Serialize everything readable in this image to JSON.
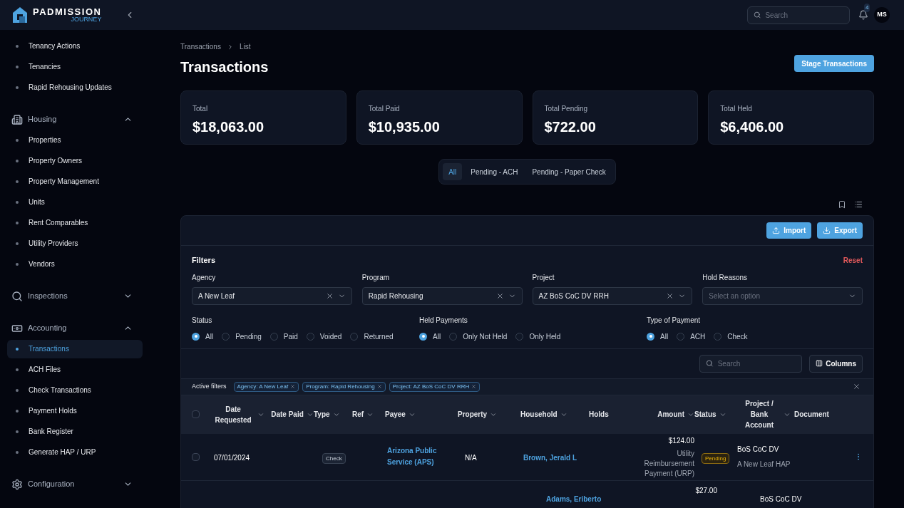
{
  "brand": {
    "name": "PADMISSION",
    "sub": "JOURNEY"
  },
  "topbar": {
    "search_placeholder": "Search",
    "notifications": "4",
    "avatar": "MS"
  },
  "sidebar": [
    {
      "kind": "item",
      "label": "Tenancy Actions",
      "selected": false
    },
    {
      "kind": "item",
      "label": "Tenancies",
      "selected": false
    },
    {
      "kind": "item",
      "label": "Rapid Rehousing Updates",
      "selected": false
    },
    {
      "kind": "section",
      "label": "Housing",
      "expanded": true
    },
    {
      "kind": "item",
      "label": "Properties",
      "selected": false
    },
    {
      "kind": "item",
      "label": "Property Owners",
      "selected": false
    },
    {
      "kind": "item",
      "label": "Property Management",
      "selected": false
    },
    {
      "kind": "item",
      "label": "Units",
      "selected": false
    },
    {
      "kind": "item",
      "label": "Rent Comparables",
      "selected": false
    },
    {
      "kind": "item",
      "label": "Utility Providers",
      "selected": false
    },
    {
      "kind": "item",
      "label": "Vendors",
      "selected": false
    },
    {
      "kind": "section",
      "label": "Inspections",
      "expanded": false
    },
    {
      "kind": "section",
      "label": "Accounting",
      "expanded": true
    },
    {
      "kind": "item",
      "label": "Transactions",
      "selected": true
    },
    {
      "kind": "item",
      "label": "ACH Files",
      "selected": false
    },
    {
      "kind": "item",
      "label": "Check Transactions",
      "selected": false
    },
    {
      "kind": "item",
      "label": "Payment Holds",
      "selected": false
    },
    {
      "kind": "item",
      "label": "Bank Register",
      "selected": false
    },
    {
      "kind": "item",
      "label": "Generate HAP / URP",
      "selected": false
    },
    {
      "kind": "section",
      "label": "Configuration",
      "expanded": false
    }
  ],
  "breadcrumb": [
    "Transactions",
    "List"
  ],
  "title": "Transactions",
  "stage_button": "Stage Transactions",
  "stats": [
    {
      "label": "Total",
      "value": "$18,063.00"
    },
    {
      "label": "Total Paid",
      "value": "$10,935.00"
    },
    {
      "label": "Total Pending",
      "value": "$722.00"
    },
    {
      "label": "Total Held",
      "value": "$6,406.00"
    }
  ],
  "tabs": [
    {
      "label": "All",
      "selected": true
    },
    {
      "label": "Pending - ACH",
      "selected": false
    },
    {
      "label": "Pending - Paper Check",
      "selected": false
    }
  ],
  "import_button": "Import",
  "export_button": "Export",
  "filters": {
    "title": "Filters",
    "reset": "Reset",
    "selects": [
      {
        "label": "Agency",
        "value": "A New Leaf"
      },
      {
        "label": "Program",
        "value": "Rapid Rehousing"
      },
      {
        "label": "Project",
        "value": "AZ BoS CoC DV RRH"
      },
      {
        "label": "Hold Reasons",
        "placeholder": "Select an option"
      }
    ],
    "radio_groups": [
      {
        "label": "Status",
        "options": [
          {
            "label": "All",
            "selected": true
          },
          {
            "label": "Pending",
            "selected": false
          },
          {
            "label": "Paid",
            "selected": false
          },
          {
            "label": "Voided",
            "selected": false
          },
          {
            "label": "Returned",
            "selected": false
          }
        ]
      },
      {
        "label": "Held Payments",
        "options": [
          {
            "label": "All",
            "selected": true
          },
          {
            "label": "Only Not Held",
            "selected": false
          },
          {
            "label": "Only Held",
            "selected": false
          }
        ]
      },
      {
        "label": "Type of Payment",
        "options": [
          {
            "label": "All",
            "selected": true
          },
          {
            "label": "ACH",
            "selected": false
          },
          {
            "label": "Check",
            "selected": false
          }
        ]
      }
    ]
  },
  "table_search_placeholder": "Search",
  "columns_button": "Columns",
  "active_filters": {
    "label": "Active filters",
    "chips": [
      "Agency: A New Leaf",
      "Program: Rapid Rehousing",
      "Project: AZ BoS CoC DV RRH"
    ]
  },
  "table": {
    "select_all_checked": false,
    "columns": [
      {
        "label": "Date Requested"
      },
      {
        "label": "Date Paid"
      },
      {
        "label": "Type"
      },
      {
        "label": "Ref"
      },
      {
        "label": "Payee"
      },
      {
        "label": "Property"
      },
      {
        "label": "Household"
      },
      {
        "label": "Holds"
      },
      {
        "label": "Amount"
      },
      {
        "label": "Status"
      },
      {
        "label": "Project / Bank Account"
      },
      {
        "label": "Document"
      }
    ],
    "rows": [
      {
        "checked": false,
        "date_requested": "07/01/2024",
        "type": "Check",
        "payee": "Arizona Public Service (APS)",
        "property": "N/A",
        "household": "Brown, Jerald L",
        "amount": "$124.00",
        "amount_note": "Utility Reimbursement Payment (URP)",
        "status": "Pending",
        "project": "BoS CoC DV",
        "bank": "A New Leaf HAP"
      },
      {
        "household": "Adams, Eriberto",
        "amount": "$27.00",
        "project": "BoS CoC DV"
      }
    ]
  }
}
